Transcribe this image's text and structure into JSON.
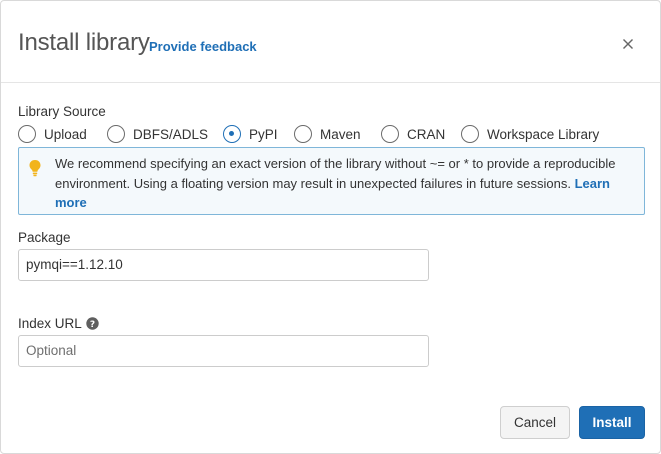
{
  "dialog": {
    "title": "Install library",
    "feedback_link": "Provide feedback",
    "close_icon": "close-icon"
  },
  "library_source": {
    "label": "Library Source",
    "options": [
      "Upload",
      "DBFS/ADLS",
      "PyPI",
      "Maven",
      "CRAN",
      "Workspace Library"
    ],
    "selected": "PyPI"
  },
  "notice": {
    "icon": "lightbulb-icon",
    "text": "We recommend specifying an exact version of the library without ~= or * to provide a reproducible environment. Using a floating version may result in unexpected failures in future sessions.",
    "link": "Learn more"
  },
  "package": {
    "label": "Package",
    "value": "pymqi==1.12.10"
  },
  "index_url": {
    "label": "Index URL",
    "placeholder": "Optional",
    "help_icon": "question-circle-icon"
  },
  "buttons": {
    "cancel": "Cancel",
    "install": "Install"
  },
  "colors": {
    "accent": "#1f6fb6",
    "notice_border": "#7fb6d9",
    "notice_bg": "#f4f9fc",
    "lightbulb": "#f2b41b"
  }
}
